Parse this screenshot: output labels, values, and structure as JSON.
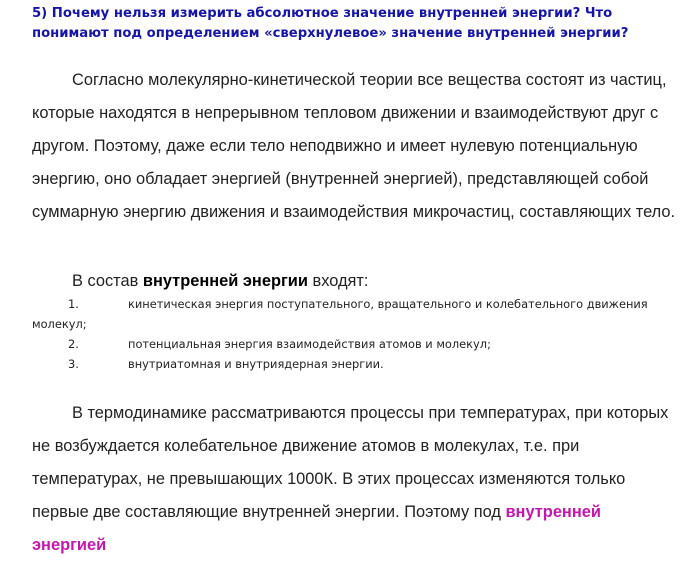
{
  "heading": "5) Почему нельзя измерить абсолютное значение внутренней энергии? Что понимают под определением «сверхнулевое» значение внутренней энергии?",
  "paragraph1": "Согласно молекулярно-кинетической теории все вещества состоят из частиц, которые находятся в непрерывном тепловом движении и взаимодействуют друг с другом. Поэтому, даже если тело неподвижно и имеет нулевую потенциальную энергию, оно обладает энергией (внутренней энергией), представляющей собой суммарную энергию движения и взаимодействия микрочастиц, составляющих тело.",
  "composition": {
    "prefix": "В состав ",
    "highlight": "внутренней энергии",
    "suffix": " входят:"
  },
  "list": [
    {
      "num": "1.",
      "text": "кинетическая энергия поступательного, вращательного и колебательного движения",
      "cont": "молекул;"
    },
    {
      "num": "2.",
      "text": "потенциальная энергия взаимодействия атомов и молекул;"
    },
    {
      "num": "3.",
      "text": "внутриатомная и внутриядерная энергии."
    }
  ],
  "paragraph3": {
    "text": "В термодинамике рассматриваются процессы при температурах, при которых не возбуждается колебательное движение атомов в молекулах, т.е. при температурах, не превышающих 1000К. В этих процессах изменяются только первые две составляющие внутренней энергии. Поэтому под ",
    "highlight": "внутренней энергией"
  },
  "colors": {
    "heading": "#1515a8",
    "highlight_black": "#000000",
    "highlight_magenta": "#c416b0"
  }
}
